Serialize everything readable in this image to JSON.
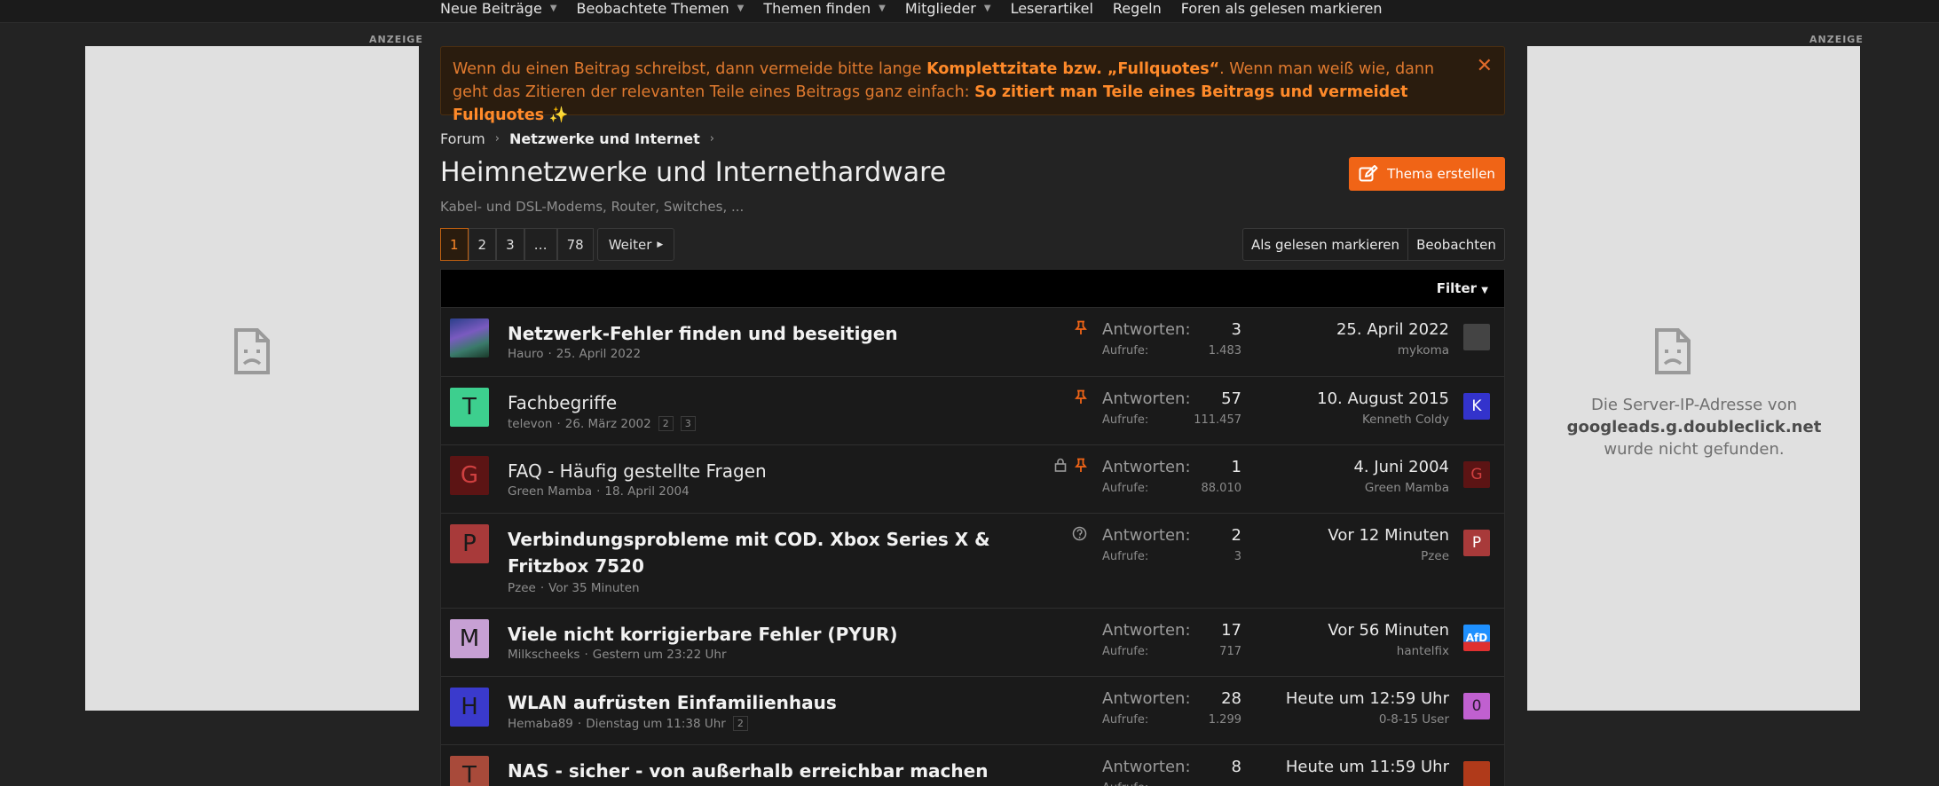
{
  "nav": {
    "items": [
      {
        "label": "Neue Beiträge",
        "caret": true
      },
      {
        "label": "Beobachtete Themen",
        "caret": true
      },
      {
        "label": "Themen finden",
        "caret": true
      },
      {
        "label": "Mitglieder",
        "caret": true
      },
      {
        "label": "Leserartikel",
        "caret": false
      },
      {
        "label": "Regeln",
        "caret": false
      },
      {
        "label": "Foren als gelesen markieren",
        "caret": false
      }
    ]
  },
  "ads": {
    "label": "ANZEIGE",
    "error_prefix": "Die Server-IP-Adresse von",
    "error_host": "googleads.g.doubleclick.net",
    "error_suffix": "wurde nicht gefunden."
  },
  "notice": {
    "text1": "Wenn du einen Beitrag schreibst, dann vermeide bitte lange ",
    "bold1": "Komplettzitate bzw. „Fullquotes“",
    "text2": ". Wenn man weiß wie, dann geht das Zitieren der relevanten Teile eines Beitrags ganz einfach: ",
    "bold2": "So zitiert man Teile eines Beitrags und vermeidet Fullquotes",
    "sparkle": "✨",
    "close": "✕"
  },
  "breadcrumb": {
    "forum": "Forum",
    "section": "Netzwerke und Internet"
  },
  "page": {
    "title": "Heimnetzwerke und Internethardware",
    "description": "Kabel- und DSL-Modems, Router, Switches, ...",
    "create_button": "Thema erstellen"
  },
  "pager": {
    "pages": [
      "1",
      "2",
      "3",
      "…",
      "78"
    ],
    "next": "Weiter"
  },
  "actions": {
    "mark_read": "Als gelesen markieren",
    "watch": "Beobachten"
  },
  "list": {
    "filter": "Filter",
    "replies_label": "Antworten:",
    "views_label": "Aufrufe:",
    "threads": [
      {
        "title": "Netzwerk-Fehler finden und beseitigen",
        "bold": true,
        "author": "Hauro",
        "date": "25. April 2022",
        "pages": [],
        "pinned": true,
        "locked": false,
        "question": false,
        "replies": "3",
        "views": "1.483",
        "last_date": "25. April 2022",
        "last_user": "mykoma",
        "avatar_letter": "",
        "avatar_color": "#5566aa",
        "last_avatar_letter": "",
        "last_avatar_color": "#444444"
      },
      {
        "title": "Fachbegriffe",
        "bold": false,
        "author": "televon",
        "date": "26. März 2002",
        "pages": [
          "2",
          "3"
        ],
        "pinned": true,
        "locked": false,
        "question": false,
        "replies": "57",
        "views": "111.457",
        "last_date": "10. August 2015",
        "last_user": "Kenneth Coldy",
        "avatar_letter": "T",
        "avatar_color": "#3dcf8e",
        "last_avatar_letter": "K",
        "last_avatar_color": "#3333cc"
      },
      {
        "title": "FAQ - Häufig gestellte Fragen",
        "bold": false,
        "author": "Green Mamba",
        "date": "18. April 2004",
        "pages": [],
        "pinned": true,
        "locked": true,
        "question": false,
        "replies": "1",
        "views": "88.010",
        "last_date": "4. Juni 2004",
        "last_user": "Green Mamba",
        "avatar_letter": "G",
        "avatar_color": "#5c1414",
        "last_avatar_letter": "G",
        "last_avatar_color": "#5c1414"
      },
      {
        "title": "Verbindungsprobleme mit COD. Xbox Series X & Fritzbox 7520",
        "bold": true,
        "author": "Pzee",
        "date": "Vor 35 Minuten",
        "pages": [],
        "pinned": false,
        "locked": false,
        "question": true,
        "replies": "2",
        "views": "3",
        "last_date": "Vor 12 Minuten",
        "last_user": "Pzee",
        "avatar_letter": "P",
        "avatar_color": "#a83a3a",
        "last_avatar_letter": "P",
        "last_avatar_color": "#a83a3a"
      },
      {
        "title": "Viele nicht korrigierbare Fehler (PYUR)",
        "bold": true,
        "author": "Milkscheeks",
        "date": "Gestern um 23:22 Uhr",
        "pages": [],
        "pinned": false,
        "locked": false,
        "question": false,
        "replies": "17",
        "views": "717",
        "last_date": "Vor 56 Minuten",
        "last_user": "hantelfix",
        "avatar_letter": "M",
        "avatar_color": "#c7a0d4",
        "last_avatar_letter": "AfD",
        "last_avatar_color": "#1e90ff"
      },
      {
        "title": "WLAN aufrüsten Einfamilienhaus",
        "bold": true,
        "author": "Hemaba89",
        "date": "Dienstag um 11:38 Uhr",
        "pages": [
          "2"
        ],
        "pinned": false,
        "locked": false,
        "question": false,
        "replies": "28",
        "views": "1.299",
        "last_date": "Heute um 12:59 Uhr",
        "last_user": "0-8-15 User",
        "avatar_letter": "H",
        "avatar_color": "#3a3acc",
        "last_avatar_letter": "0",
        "last_avatar_color": "#c060d0"
      },
      {
        "title": "NAS - sicher - von außerhalb erreichbar machen",
        "bold": true,
        "author": "",
        "date": "",
        "pages": [],
        "pinned": false,
        "locked": false,
        "question": false,
        "replies": "8",
        "views": "",
        "last_date": "Heute um 11:59 Uhr",
        "last_user": "",
        "avatar_letter": "T",
        "avatar_color": "#a84a3a",
        "last_avatar_letter": "",
        "last_avatar_color": "#b03a1a"
      }
    ]
  }
}
